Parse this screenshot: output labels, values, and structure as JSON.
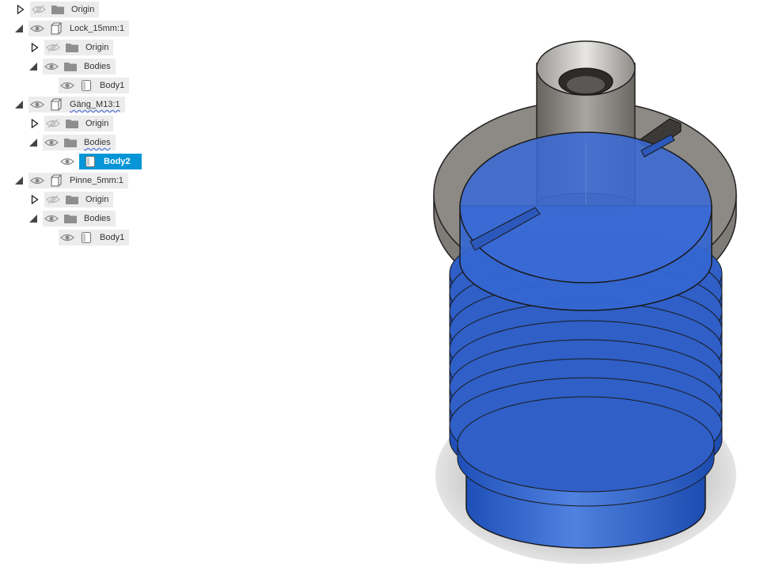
{
  "browser_tree": {
    "rows": [
      {
        "label": "Origin",
        "expander": "collapsed",
        "visible": false,
        "icon": "folder-icon"
      },
      {
        "label": "Lock_15mm:1",
        "expander": "expanded",
        "visible": true,
        "icon": "component-icon"
      },
      {
        "label": "Origin",
        "expander": "collapsed",
        "visible": false,
        "icon": "folder-icon"
      },
      {
        "label": "Bodies",
        "expander": "expanded",
        "visible": true,
        "icon": "folder-icon"
      },
      {
        "label": "Body1",
        "expander": "none",
        "visible": true,
        "icon": "body-icon"
      },
      {
        "label": "Gäng_M13:1",
        "expander": "expanded",
        "visible": true,
        "icon": "component-icon"
      },
      {
        "label": "Origin",
        "expander": "collapsed",
        "visible": false,
        "icon": "folder-icon"
      },
      {
        "label": "Bodies",
        "expander": "expanded",
        "visible": true,
        "icon": "folder-icon"
      },
      {
        "label": "Body2",
        "expander": "none",
        "visible": true,
        "icon": "body-icon",
        "selected": true
      },
      {
        "label": "Pinne_5mm:1",
        "expander": "expanded",
        "visible": true,
        "icon": "component-icon"
      },
      {
        "label": "Origin",
        "expander": "collapsed",
        "visible": false,
        "icon": "folder-icon"
      },
      {
        "label": "Bodies",
        "expander": "expanded",
        "visible": true,
        "icon": "folder-icon"
      },
      {
        "label": "Body1",
        "expander": "none",
        "visible": true,
        "icon": "body-icon"
      }
    ]
  },
  "colors": {
    "selection": "#0696d7",
    "body_blue": "#2f63cc",
    "body_gray": "#8a8784",
    "chip_bg": "#ececec"
  }
}
